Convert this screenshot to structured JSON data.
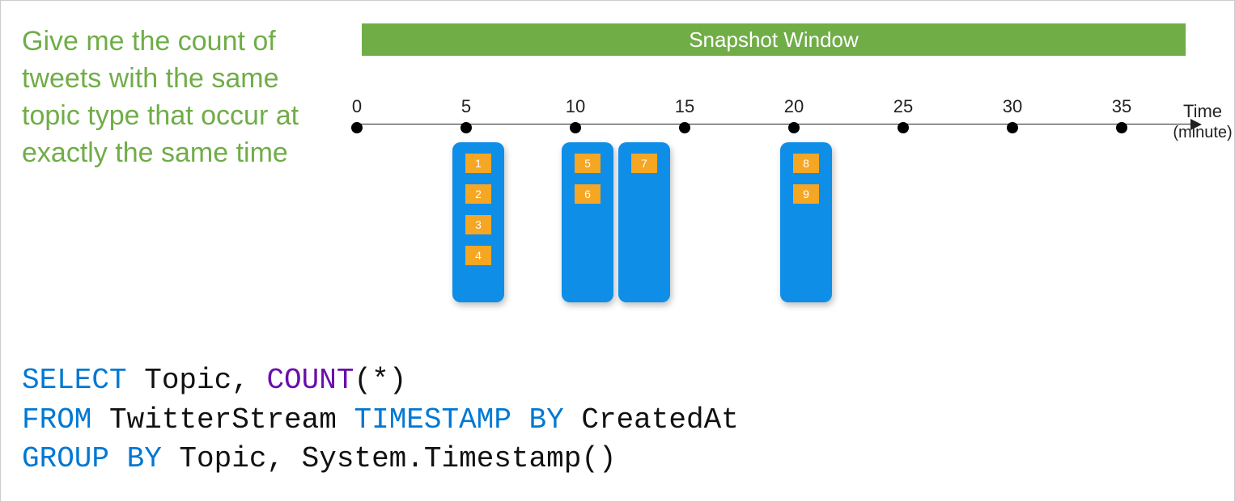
{
  "description": "Give me the count of tweets with the same topic type that occur at exactly the same time",
  "banner": "Snapshot Window",
  "timeline": {
    "ticks": [
      "0",
      "5",
      "10",
      "15",
      "20",
      "25",
      "30",
      "35"
    ],
    "axis_label": "Time",
    "axis_sub": "(minute)"
  },
  "groups": [
    {
      "position": 1,
      "events": [
        "1",
        "2",
        "3",
        "4"
      ]
    },
    {
      "position": 2,
      "events": [
        "5",
        "6"
      ]
    },
    {
      "position": 2.5,
      "events": [
        "7"
      ]
    },
    {
      "position": 4,
      "events": [
        "8",
        "9"
      ]
    }
  ],
  "sql": {
    "select": "SELECT",
    "topic": " Topic, ",
    "count": "COUNT",
    "count_args": "(*)",
    "from": "FROM",
    "from_rest": " TwitterStream ",
    "timestamp_by": "TIMESTAMP BY",
    "ts_rest": " CreatedAt",
    "group_by": "GROUP BY",
    "gb_rest": " Topic, System.Timestamp()"
  }
}
